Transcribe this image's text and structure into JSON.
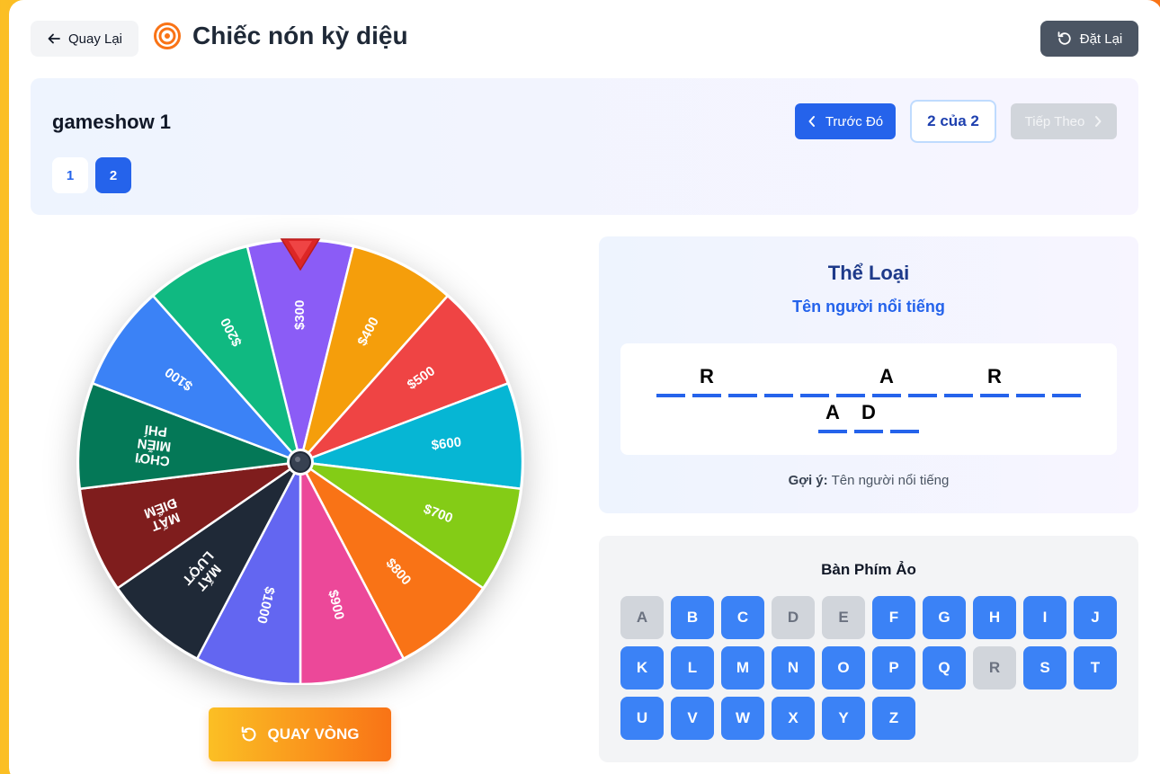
{
  "header": {
    "back_label": "Quay Lại",
    "title": "Chiếc nón kỳ diệu",
    "reset_label": "Đặt Lại"
  },
  "game": {
    "name": "gameshow 1",
    "rounds": [
      "1",
      "2"
    ],
    "current_round": 2,
    "prev_label": "Trước Đó",
    "counter": "2 của 2",
    "next_label": "Tiếp Theo"
  },
  "wheel": {
    "segments": [
      {
        "label": "$300",
        "color": "#8b5cf6"
      },
      {
        "label": "$400",
        "color": "#f59e0b"
      },
      {
        "label": "$500",
        "color": "#ef4444"
      },
      {
        "label": "$600",
        "color": "#06b6d4"
      },
      {
        "label": "$700",
        "color": "#84cc16"
      },
      {
        "label": "$800",
        "color": "#f97316"
      },
      {
        "label": "$900",
        "color": "#ec4899"
      },
      {
        "label": "$1000",
        "color": "#6366f1"
      },
      {
        "label": "MẤT LƯỢT",
        "color": "#1f2937"
      },
      {
        "label": "MẤT ĐIỂM",
        "color": "#7f1d1d"
      },
      {
        "label": "CHƠI MIỄN PHÍ",
        "color": "#047857"
      },
      {
        "label": "$100",
        "color": "#3b82f6"
      },
      {
        "label": "$200",
        "color": "#10b981"
      }
    ],
    "spin_label": "QUAY VÒNG"
  },
  "category": {
    "heading": "Thể Loại",
    "name": "Tên người nổi tiếng",
    "puzzle_rows": [
      [
        "",
        "R",
        "",
        "",
        "",
        "",
        "A",
        "",
        "",
        "R",
        "",
        ""
      ],
      [
        "A",
        "D",
        ""
      ]
    ],
    "hint_label": "Gợi ý:",
    "hint_text": "Tên người nổi tiếng"
  },
  "keyboard": {
    "title": "Bàn Phím Ảo",
    "keys": [
      "A",
      "B",
      "C",
      "D",
      "E",
      "F",
      "G",
      "H",
      "I",
      "J",
      "K",
      "L",
      "M",
      "N",
      "O",
      "P",
      "Q",
      "R",
      "S",
      "T",
      "U",
      "V",
      "W",
      "X",
      "Y",
      "Z"
    ],
    "used_keys": [
      "A",
      "D",
      "E",
      "R"
    ]
  },
  "colors": {
    "primary": "#2563eb",
    "key_active": "#3b82f6",
    "key_used": "#d1d5db",
    "pointer": "#dc2626"
  }
}
